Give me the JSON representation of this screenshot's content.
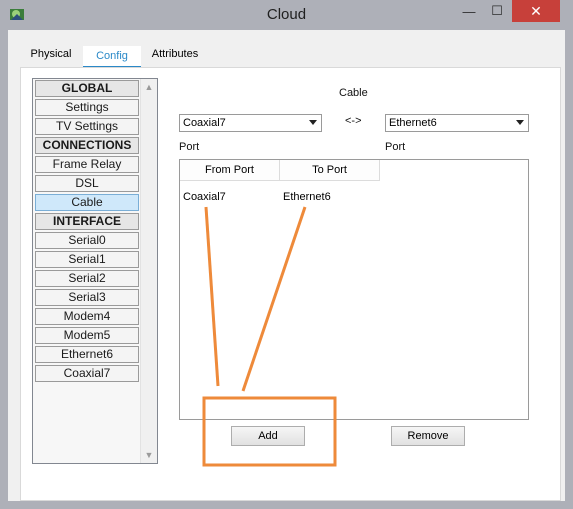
{
  "window": {
    "title": "Cloud",
    "minimize": "—",
    "maximize": "☐",
    "close": "✕"
  },
  "tabs": [
    {
      "label": "Physical"
    },
    {
      "label": "Config"
    },
    {
      "label": "Attributes"
    }
  ],
  "sidebar": {
    "items": [
      {
        "label": "GLOBAL"
      },
      {
        "label": "Settings"
      },
      {
        "label": "TV Settings"
      },
      {
        "label": "CONNECTIONS"
      },
      {
        "label": "Frame Relay"
      },
      {
        "label": "DSL"
      },
      {
        "label": "Cable"
      },
      {
        "label": "INTERFACE"
      },
      {
        "label": "Serial0"
      },
      {
        "label": "Serial1"
      },
      {
        "label": "Serial2"
      },
      {
        "label": "Serial3"
      },
      {
        "label": "Modem4"
      },
      {
        "label": "Modem5"
      },
      {
        "label": "Ethernet6"
      },
      {
        "label": "Coaxial7"
      }
    ],
    "scroll_up": "▲",
    "scroll_down": "▼"
  },
  "cable": {
    "title": "Cable",
    "left_select": "Coaxial7",
    "right_select": "Ethernet6",
    "arrow": "<->",
    "left_port_label": "Port",
    "right_port_label": "Port"
  },
  "table": {
    "headers": [
      "From Port",
      "To Port"
    ],
    "rows": [
      {
        "from": "Coaxial7",
        "to": "Ethernet6"
      }
    ]
  },
  "buttons": {
    "add": "Add",
    "remove": "Remove"
  },
  "colors": {
    "annotation": "#ee8a3a",
    "selected_bg": "#cfe8fa",
    "close_bg": "#c7403a",
    "tab_active": "#2a89c8"
  }
}
